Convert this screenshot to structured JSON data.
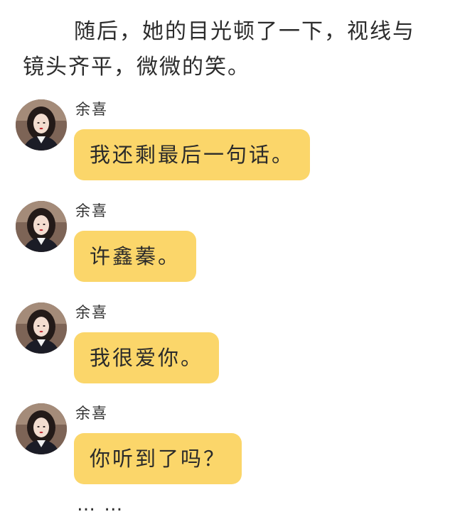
{
  "narration": "随后，她的目光顿了一下，视线与镜头齐平，微微的笑。",
  "messages": [
    {
      "sender": "余喜",
      "text": "我还剩最后一句话。"
    },
    {
      "sender": "余喜",
      "text": "许鑫蓁。"
    },
    {
      "sender": "余喜",
      "text": "我很爱你。"
    },
    {
      "sender": "余喜",
      "text": "你听到了吗？"
    }
  ],
  "ellipsis": "… …",
  "colors": {
    "bubble": "#fbd66a",
    "text": "#2a2a2a",
    "background": "#ffffff"
  },
  "icons": {
    "avatar": "avatar-portrait"
  }
}
